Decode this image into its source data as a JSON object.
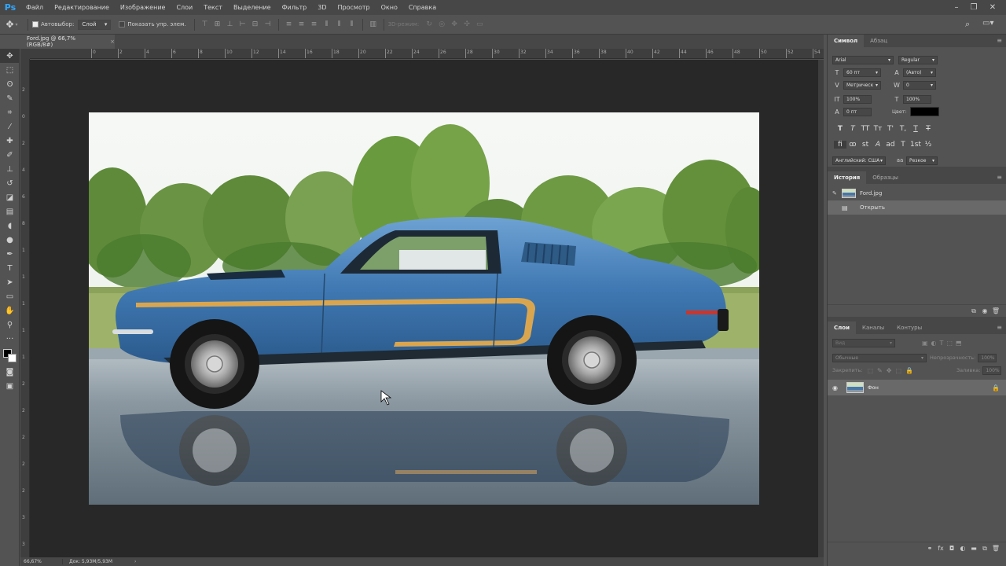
{
  "app": {
    "logo": "Ps"
  },
  "menu": [
    "Файл",
    "Редактирование",
    "Изображение",
    "Слои",
    "Текст",
    "Выделение",
    "Фильтр",
    "3D",
    "Просмотр",
    "Окно",
    "Справка"
  ],
  "window_controls": [
    "minimize-icon",
    "restore-icon",
    "close-icon"
  ],
  "options": {
    "auto_select_label": "Автовыбор:",
    "auto_select_value": "Слой",
    "show_transform_label": "Показать упр. элем.",
    "mode_3d_label": "3D-режим:"
  },
  "document": {
    "tab_label": "Ford.jpg @ 66,7% (RGB/8#)",
    "tab_close": "×",
    "image_subject": "Blue classic Ford Mustang fastback on wet pavement with reflection"
  },
  "ruler_h": [
    "0",
    "2",
    "4",
    "6",
    "8",
    "10",
    "12",
    "14",
    "16",
    "18",
    "20",
    "22",
    "24",
    "26",
    "28",
    "30",
    "32",
    "34",
    "36",
    "38",
    "40",
    "42",
    "44",
    "46",
    "48",
    "50",
    "52",
    "54"
  ],
  "status": {
    "zoom": "66,67%",
    "doc_info": "Док: 5,93M/5,93M"
  },
  "character_panel": {
    "tabs": [
      "Символ",
      "Абзац"
    ],
    "font_family": "Arial",
    "font_style": "Regular",
    "font_size": "60 пт",
    "leading": "(Авто)",
    "kerning": "Метрическ",
    "tracking": "0",
    "vscale": "100%",
    "hscale": "100%",
    "baseline": "0 пт",
    "color_label": "Цвет:",
    "color": "#000000",
    "style_buttons": [
      "T",
      "T",
      "TT",
      "Tт",
      "T'",
      "T,",
      "T",
      "T"
    ],
    "opentype_buttons": [
      "fi",
      "ꝏ",
      "st",
      "A",
      "ad",
      "T",
      "1st",
      "½"
    ],
    "language": "Английский: США",
    "antialias": "Резкое"
  },
  "history_panel": {
    "tabs": [
      "История",
      "Образцы"
    ],
    "snapshot_name": "Ford.jpg",
    "steps": [
      "Открыть"
    ]
  },
  "layers_panel": {
    "tabs": [
      "Слои",
      "Каналы",
      "Контуры"
    ],
    "filter_placeholder": "Вид",
    "blend_mode": "Обычные",
    "opacity_label": "Непрозрачность:",
    "opacity_value": "100%",
    "lock_label": "Закрепить:",
    "fill_label": "Заливка:",
    "fill_value": "100%",
    "layers": [
      {
        "name": "Фон",
        "visible": true,
        "locked": true
      }
    ]
  }
}
